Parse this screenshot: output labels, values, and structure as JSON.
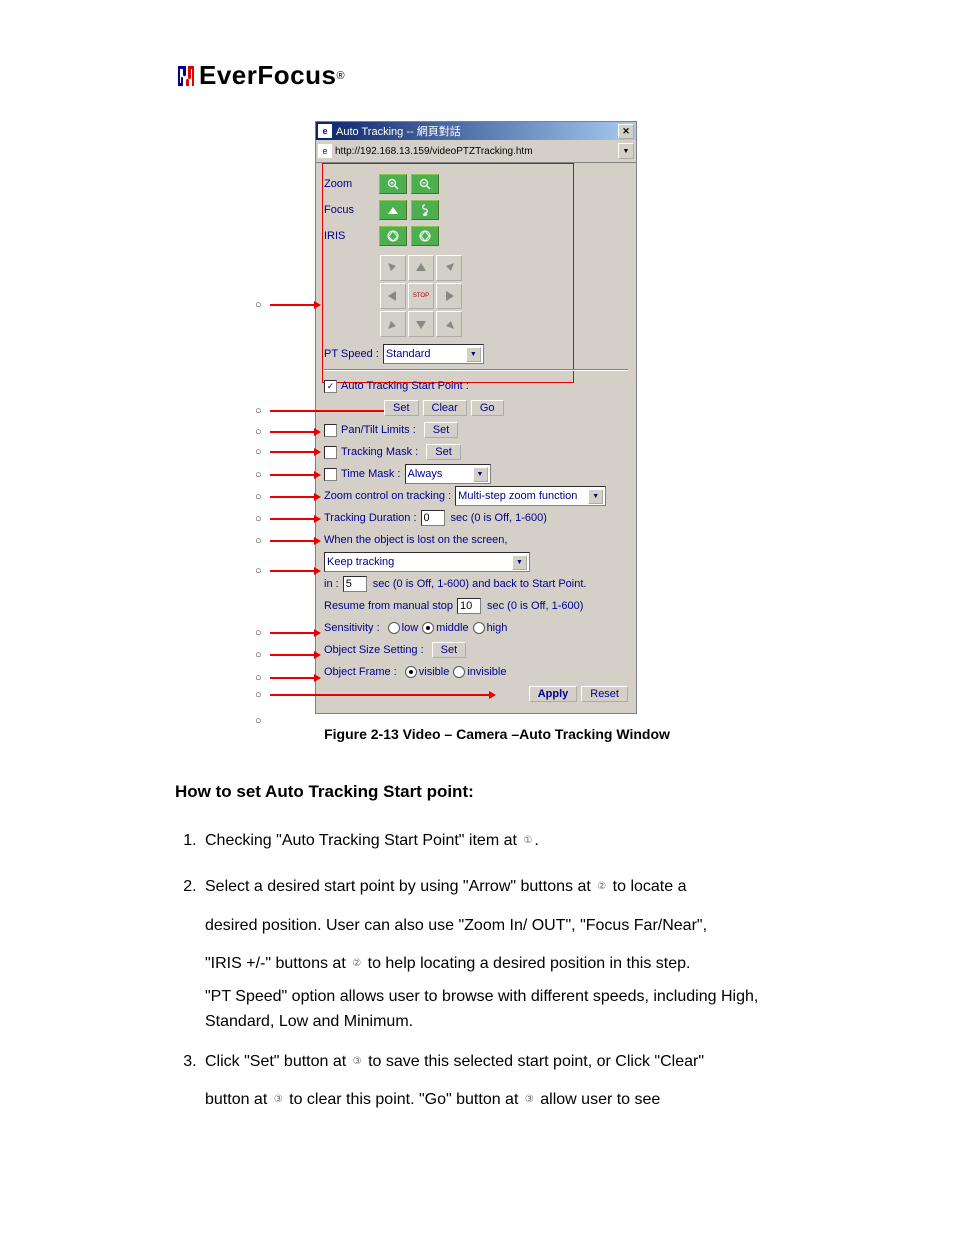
{
  "logo": {
    "text": "EverFocus",
    "reg": "®"
  },
  "window": {
    "title": "Auto Tracking -- 網頁對話",
    "url": "http://192.168.13.159/videoPTZTracking.htm"
  },
  "controls": {
    "zoom_label": "Zoom",
    "focus_label": "Focus",
    "iris_label": "IRIS",
    "stop": "STOP",
    "ptspeed_label": "PT Speed :",
    "ptspeed_value": "Standard"
  },
  "form": {
    "atsp_checked": "✓",
    "atsp_label": "Auto Tracking Start Point :",
    "set": "Set",
    "clear": "Clear",
    "go": "Go",
    "ptlimits_label": "Pan/Tilt Limits :",
    "trmask_label": "Tracking Mask :",
    "timemask_label": "Time Mask :",
    "timemask_value": "Always",
    "zoomctrl_label": "Zoom control on tracking :",
    "zoomctrl_value": "Multi-step zoom function",
    "trdur_label": "Tracking Duration :",
    "trdur_value": "0",
    "trdur_tail": "sec (0 is Off, 1-600)",
    "lost_label": "When the object is lost on the screen,",
    "lost_value": "Keep tracking",
    "in_label": "in :",
    "in_value": "5",
    "in_tail": "sec (0 is Off, 1-600)  and back to Start Point.",
    "resume_label": "Resume from manual stop",
    "resume_value": "10",
    "resume_tail": "sec (0 is Off, 1-600)",
    "sens_label": "Sensitivity :",
    "sens_low": "low",
    "sens_mid": "middle",
    "sens_high": "high",
    "objsize_label": "Object Size Setting :",
    "objframe_label": "Object Frame :",
    "objframe_vis": "visible",
    "objframe_invis": "invisible",
    "apply": "Apply",
    "reset": "Reset"
  },
  "figure_caption": "Figure 2-13 Video – Camera –Auto Tracking Window",
  "heading": "How to set Auto Tracking Start point:",
  "steps": {
    "s1": "Checking \"Auto Tracking Start Point\" item at ",
    "s1_tail": ".",
    "s2_a": "Select a desired start point by using \"Arrow\" buttons at ",
    "s2_b": " to locate a",
    "s2_c": "desired position. User can also use \"Zoom In/ OUT\", \"Focus Far/Near\",",
    "s2_d": "\"IRIS +/-\" buttons at ",
    "s2_e": " to help locating a desired position in this step.",
    "s2_f": "\"PT Speed\" option allows user to browse with different speeds, including High, Standard, Low and Minimum.",
    "s3_a": "Click \"Set\" button at ",
    "s3_b": " to save this selected start point, or Click \"Clear\"",
    "s3_c": "button at ",
    "s3_d": " to clear this point. \"Go\" button at ",
    "s3_e": " allow user to see"
  },
  "refs": {
    "r1": "①",
    "r2": "②",
    "r3": "③"
  }
}
